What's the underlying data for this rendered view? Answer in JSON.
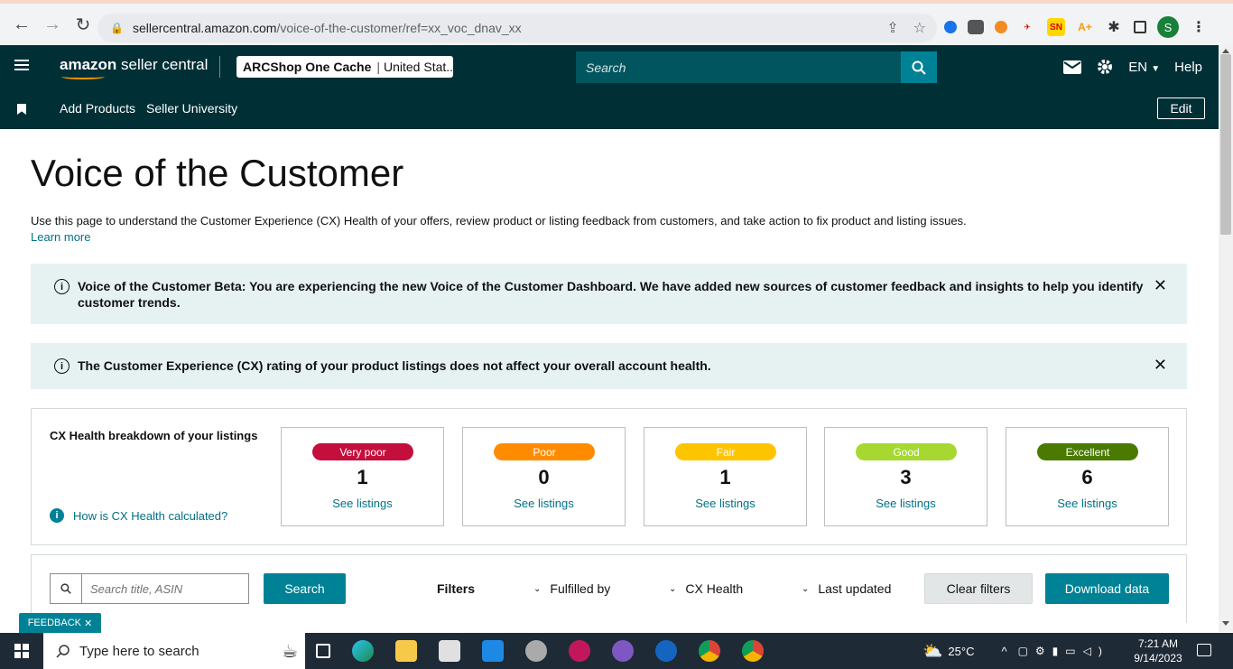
{
  "browser": {
    "url_host": "sellercentral.amazon.com",
    "url_path": "/voice-of-the-customer/ref=xx_voc_dnav_xx",
    "extensions": [
      "SN",
      "A+"
    ],
    "profile_initial": "S"
  },
  "header": {
    "logo_bold": "amazon",
    "logo_rest": " seller central",
    "store_name": "ARCShop One Cache",
    "store_region": "United Stat...",
    "search_placeholder": "Search",
    "language": "EN",
    "help": "Help"
  },
  "subnav": {
    "items": [
      "Add Products",
      "Seller University"
    ],
    "edit": "Edit"
  },
  "page": {
    "title": "Voice of the Customer",
    "description": "Use this page to understand the Customer Experience (CX) Health of your offers, review product or listing feedback from customers, and take action to fix product and listing issues.",
    "learn_more": "Learn more"
  },
  "alerts": [
    {
      "text": "Voice of the Customer Beta: You are experiencing the new Voice of the Customer Dashboard. We have added new sources of customer feedback and insights to help you identify customer trends."
    },
    {
      "text": "The Customer Experience (CX) rating of your product listings does not affect your overall account health."
    }
  ],
  "cx_health": {
    "title": "CX Health breakdown of your listings",
    "how_link": "How is CX Health calculated?",
    "cards": [
      {
        "label": "Very poor",
        "count": "1",
        "link": "See listings",
        "color": "#c40e3c",
        "text_color": "#ffffff"
      },
      {
        "label": "Poor",
        "count": "0",
        "link": "See listings",
        "color": "#ff8c00",
        "text_color": "#ffffff"
      },
      {
        "label": "Fair",
        "count": "1",
        "link": "See listings",
        "color": "#ffc400",
        "text_color": "#ffffff"
      },
      {
        "label": "Good",
        "count": "3",
        "link": "See listings",
        "color": "#a6d831",
        "text_color": "#ffffff"
      },
      {
        "label": "Excellent",
        "count": "6",
        "link": "See listings",
        "color": "#4a7a00",
        "text_color": "#ffffff"
      }
    ]
  },
  "filters": {
    "search_placeholder": "Search title, ASIN",
    "search_button": "Search",
    "label": "Filters",
    "dropdowns": [
      "Fulfilled by",
      "CX Health",
      "Last updated"
    ],
    "clear": "Clear filters",
    "download": "Download data"
  },
  "feedback": "FEEDBACK",
  "taskbar": {
    "search_placeholder": "Type here to search",
    "temperature": "25°C",
    "time": "7:21 AM",
    "date": "9/14/2023"
  }
}
